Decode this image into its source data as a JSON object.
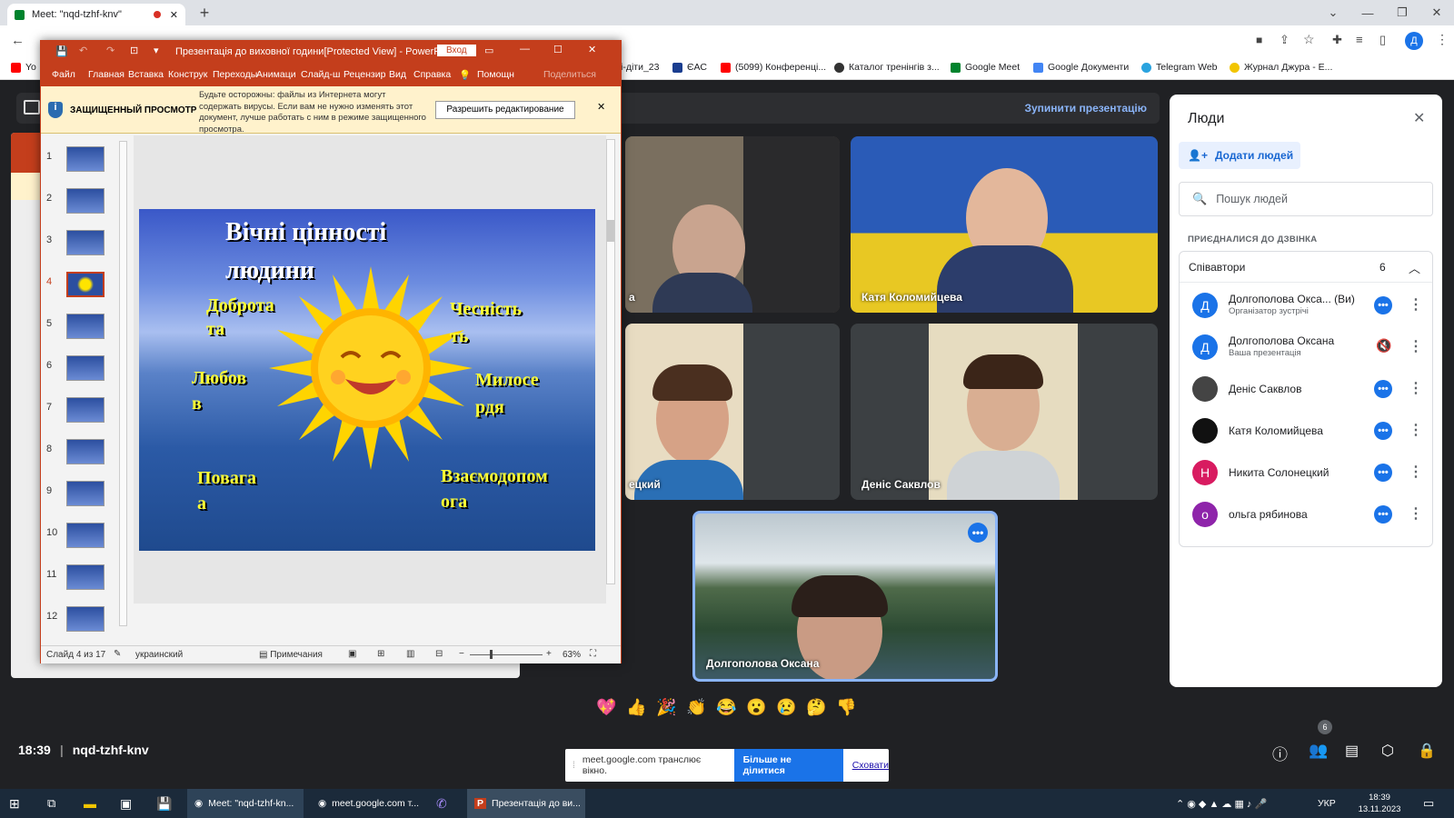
{
  "browser": {
    "tab_title": "Meet: \"nqd-tzhf-knv\"",
    "bookmarks": [
      "Yo",
      "і-діти_23",
      "ЄАС",
      "(5099) Конференці...",
      "Каталог тренінгів з...",
      "Google Meet",
      "Google Документи",
      "Telegram Web",
      "Журнал Джура - Е..."
    ]
  },
  "meet": {
    "stop_presentation": "Зупинити презентацію",
    "tiles": [
      {
        "name": "а"
      },
      {
        "name": "Катя Коломийцева"
      },
      {
        "name": "ецкий"
      },
      {
        "name": "Деніс Саквлов"
      },
      {
        "name": "Долгополова Оксана"
      }
    ],
    "time": "18:39",
    "meeting_code": "nqd-tzhf-knv",
    "participants_badge": "6",
    "emojis": [
      "💖",
      "👍",
      "🎉",
      "👏",
      "😂",
      "😮",
      "😢",
      "🤔",
      "👎"
    ],
    "share_bar": {
      "text": "meet.google.com транслює вікно.",
      "stop_button": "Більше не ділитися",
      "hide_link": "Сховати"
    }
  },
  "people": {
    "title": "Люди",
    "add_button": "Додати людей",
    "search_placeholder": "Пошук людей",
    "section_label": "ПРИЄДНАЛИСЯ ДО ДЗВІНКА",
    "group": {
      "label": "Співавтори",
      "count": "6"
    },
    "list": [
      {
        "initial": "Д",
        "color": "#1a73e8",
        "name": "Долгополова Окса...  (Ви)",
        "sub": "Організатор зустрічі"
      },
      {
        "initial": "Д",
        "color": "#1a73e8",
        "name": "Долгополова Оксана",
        "sub": "Ваша презентація"
      },
      {
        "initial": "",
        "color": "#444444",
        "name": "Деніс Саквлов",
        "sub": ""
      },
      {
        "initial": "",
        "color": "#111111",
        "name": "Катя Коломийцева",
        "sub": ""
      },
      {
        "initial": "Н",
        "color": "#d81b60",
        "name": "Никита Солонецкий",
        "sub": ""
      },
      {
        "initial": "о",
        "color": "#8e24aa",
        "name": "ольга рябинова",
        "sub": ""
      }
    ]
  },
  "ppt": {
    "title": "Презентація до виховної години[Protected View]  -  PowerP...",
    "signin": "Вход",
    "menu": [
      "Файл",
      "Главная",
      "Вставка",
      "Конструк",
      "Переходы",
      "Анимаци",
      "Слайд-ш",
      "Рецензир",
      "Вид",
      "Справка",
      "Помощн",
      "Поделиться"
    ],
    "protected_label": "ЗАЩИЩЕННЫЙ ПРОСМОТР",
    "protected_text": "Будьте осторожны: файлы из Интернета могут содержать вирусы. Если вам не нужно изменять этот документ, лучше работать с ним в режиме защищенного просмотра.",
    "enable_editing": "Разрешить редактирование",
    "thumb_numbers": [
      "1",
      "2",
      "3",
      "4",
      "5",
      "6",
      "7",
      "8",
      "9",
      "10",
      "11",
      "12"
    ],
    "slide": {
      "title_line1": "Вічні цінності",
      "title_line2": "людини",
      "w1a": "Доброта",
      "w1b": "та",
      "w2a": "Чесність",
      "w2b": "ть",
      "w3a": "Любов",
      "w3b": "в",
      "w4a": "Милосе",
      "w4b": "рдя",
      "w5a": "Повага",
      "w5b": "а",
      "w6a": "Взаємодопом",
      "w6b": "ога"
    },
    "status": {
      "slide": "Слайд 4 из 17",
      "lang": "украинский",
      "notes": "Примечания",
      "zoom": "63%"
    }
  },
  "taskbar": {
    "items": [
      "Meet: \"nqd-tzhf-kn...",
      "meet.google.com т...",
      "Презентація до ви..."
    ],
    "lang": "УКР",
    "time": "18:39",
    "date": "13.11.2023"
  }
}
